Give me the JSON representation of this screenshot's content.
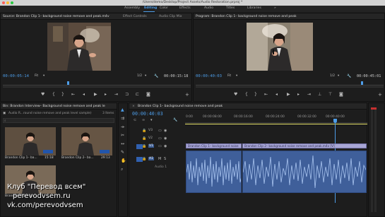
{
  "window": {
    "title": "/Users/demo/Desktop/Project Assets/Audio Restoration.prproj *"
  },
  "workspaces": [
    "Assembly",
    "Editing",
    "Color",
    "Effects",
    "Audio",
    "Titles",
    "Libraries"
  ],
  "active_workspace": "Editing",
  "source_panel": {
    "tab_label": "Source: Brandon Clip 1– background noise remove and peak.m4v",
    "tabs": [
      "Effect Controls",
      "Audio Clip Mix"
    ],
    "timecode_left": "00:00:05:14",
    "fit": "Fit",
    "scale": "1/2",
    "timecode_right": "00:00:15:18"
  },
  "program_panel": {
    "tab_label": "Program: Brandon Clip 1– background noise remove and peak",
    "timecode_left": "00:00:40:03",
    "fit": "Fit",
    "scale": "1/2",
    "timecode_right": "00:00:45:01"
  },
  "bin_panel": {
    "tab_label": "Bin: Brandon Interview– Background noise remove and peak le",
    "path": "Audio R...round noise remove and peak level sample)",
    "count": "3 Items",
    "items": [
      {
        "name": "Brandon Clip 1– ba...",
        "duration": "15:18"
      },
      {
        "name": "Brandon Clip 2– ba...",
        "duration": "29:13"
      },
      {
        "name": "Brandon Clip 3– ba...",
        "duration": ""
      }
    ]
  },
  "timeline": {
    "tab_label": "Brandon Clip 1– background noise remove and peak",
    "timecode": "00:00:40:03",
    "ruler": [
      "0:00",
      "00:00:08:00",
      "00:00:16:00",
      "00:00:24:00",
      "00:00:32:00",
      "00:00:40:00"
    ],
    "tracks_video": [
      "V3",
      "V2",
      "V1"
    ],
    "tracks_audio": [
      "A1",
      "A2"
    ],
    "audio_track_name": "Audio 1",
    "clips": [
      {
        "label": "Brandon Clip 1– background noise"
      },
      {
        "label": "Brandon Clip 2– background noise remove and peak.m4v [V]"
      }
    ]
  },
  "watermark": {
    "line1": "Клуб \"Перевод всем\"",
    "line2": "perevodvsem.ru",
    "line3": "vk.com/perevodvsem"
  }
}
